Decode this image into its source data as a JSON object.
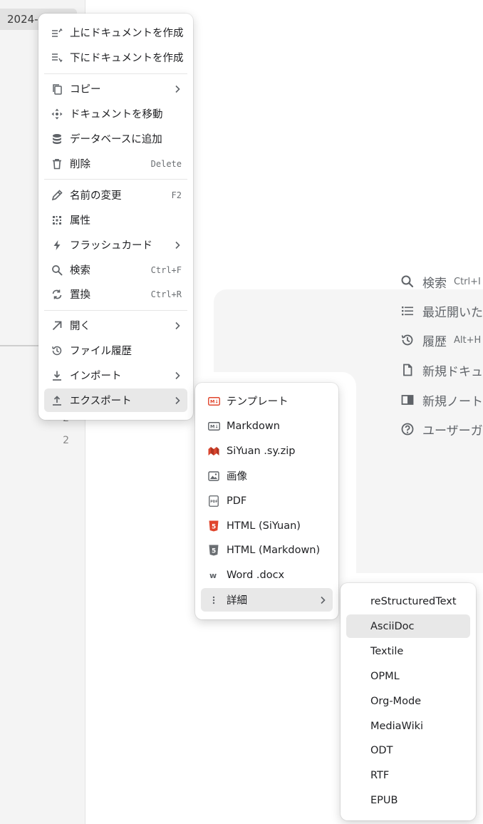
{
  "sidebar": {
    "date_label": "2024-",
    "numbers": [
      "2",
      "2"
    ]
  },
  "quick_actions": [
    {
      "icon": "search-icon",
      "label": "検索",
      "shortcut": "Ctrl+I"
    },
    {
      "icon": "list-icon",
      "label": "最近開いた",
      "shortcut": ""
    },
    {
      "icon": "history-icon",
      "label": "履歴",
      "shortcut": "Alt+H"
    },
    {
      "icon": "file-icon",
      "label": "新規ドキュメ",
      "shortcut": ""
    },
    {
      "icon": "notebook-icon",
      "label": "新規ノートフ",
      "shortcut": ""
    },
    {
      "icon": "help-icon",
      "label": "ユーザーガイ",
      "shortcut": ""
    }
  ],
  "context_menu": {
    "items": [
      {
        "icon": "insert-above-icon",
        "label": "上にドキュメントを作成",
        "shortcut": ""
      },
      {
        "icon": "insert-below-icon",
        "label": "下にドキュメントを作成",
        "shortcut": ""
      },
      {
        "icon": "copy-icon",
        "label": "コピー",
        "shortcut": "",
        "submenu": true
      },
      {
        "icon": "move-icon",
        "label": "ドキュメントを移動",
        "shortcut": ""
      },
      {
        "icon": "database-icon",
        "label": "データベースに追加",
        "shortcut": ""
      },
      {
        "icon": "trash-icon",
        "label": "削除",
        "shortcut": "Delete"
      },
      {
        "icon": "pencil-icon",
        "label": "名前の変更",
        "shortcut": "F2"
      },
      {
        "icon": "attributes-icon",
        "label": "属性",
        "shortcut": ""
      },
      {
        "icon": "flashcard-icon",
        "label": "フラッシュカード",
        "shortcut": "",
        "submenu": true
      },
      {
        "icon": "search-icon",
        "label": "検索",
        "shortcut": "Ctrl+F"
      },
      {
        "icon": "replace-icon",
        "label": "置換",
        "shortcut": "Ctrl+R"
      },
      {
        "icon": "open-icon",
        "label": "開く",
        "shortcut": "",
        "submenu": true
      },
      {
        "icon": "history-icon",
        "label": "ファイル履歴",
        "shortcut": ""
      },
      {
        "icon": "import-icon",
        "label": "インポート",
        "shortcut": "",
        "submenu": true
      },
      {
        "icon": "export-icon",
        "label": "エクスポート",
        "shortcut": "",
        "submenu": true,
        "active": true
      }
    ]
  },
  "export_menu": {
    "items": [
      {
        "icon": "template-icon",
        "label": "テンプレート"
      },
      {
        "icon": "markdown-icon",
        "label": "Markdown"
      },
      {
        "icon": "siyuan-icon",
        "label": "SiYuan .sy.zip"
      },
      {
        "icon": "image-icon",
        "label": "画像"
      },
      {
        "icon": "pdf-icon",
        "label": "PDF"
      },
      {
        "icon": "html5-icon",
        "label": "HTML (SiYuan)"
      },
      {
        "icon": "html5-gray-icon",
        "label": "HTML (Markdown)"
      },
      {
        "icon": "word-icon",
        "label": "Word .docx"
      },
      {
        "icon": "more-vertical-icon",
        "label": "詳細",
        "submenu": true,
        "active": true
      }
    ]
  },
  "more_menu": {
    "items": [
      {
        "label": "reStructuredText"
      },
      {
        "label": "AsciiDoc",
        "active": true
      },
      {
        "label": "Textile"
      },
      {
        "label": "OPML"
      },
      {
        "label": "Org-Mode"
      },
      {
        "label": "MediaWiki"
      },
      {
        "label": "ODT"
      },
      {
        "label": "RTF"
      },
      {
        "label": "EPUB"
      }
    ]
  },
  "colors": {
    "accent_red": "#e0452c",
    "icon_gray": "#5f6368",
    "active_bg": "#e8e8e8"
  }
}
